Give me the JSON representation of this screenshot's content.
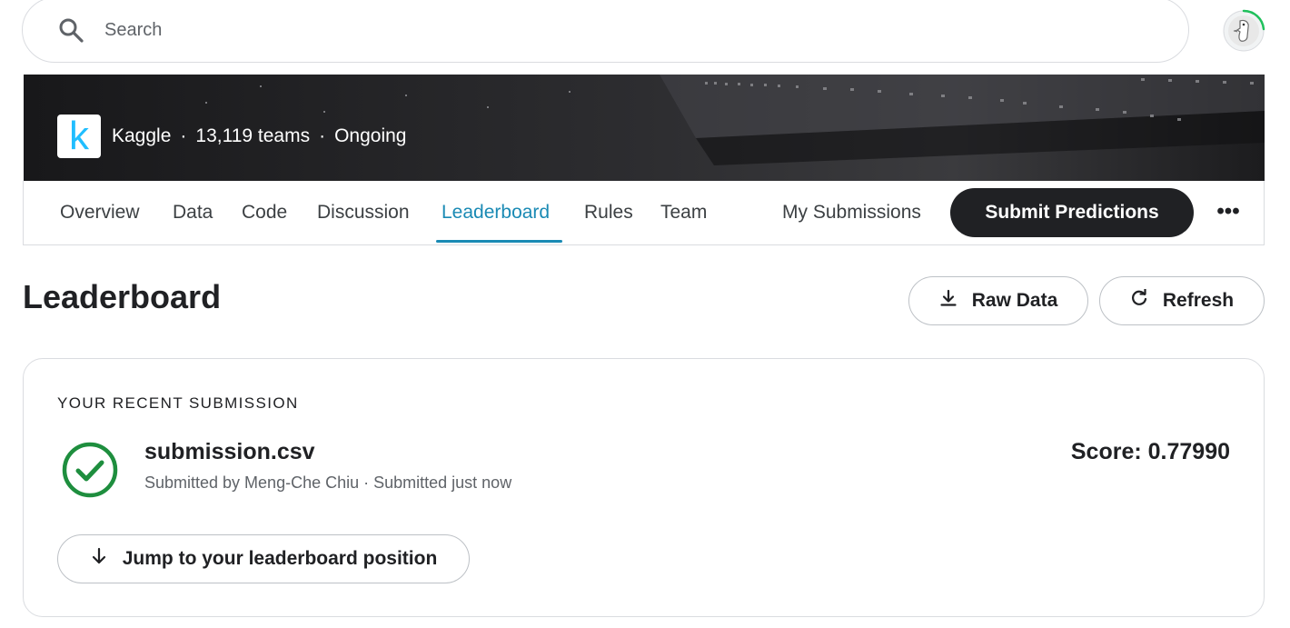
{
  "search": {
    "placeholder": "Search"
  },
  "competition": {
    "org": "Kaggle",
    "org_logo_letter": "k",
    "teams": "13,119 teams",
    "status": "Ongoing",
    "separator": "·"
  },
  "tabs": [
    {
      "label": "Overview"
    },
    {
      "label": "Data"
    },
    {
      "label": "Code"
    },
    {
      "label": "Discussion"
    },
    {
      "label": "Leaderboard",
      "active": true
    },
    {
      "label": "Rules"
    },
    {
      "label": "Team"
    }
  ],
  "actions": {
    "my_submissions": "My Submissions",
    "submit_predictions": "Submit Predictions",
    "more": "•••"
  },
  "page": {
    "title": "Leaderboard",
    "raw_data": "Raw Data",
    "refresh": "Refresh"
  },
  "recent_submission": {
    "label": "YOUR RECENT SUBMISSION",
    "file_name": "submission.csv",
    "meta": "Submitted by Meng-Che Chiu · Submitted just now",
    "score": "Score: 0.77990",
    "jump": "Jump to your leaderboard position",
    "status_icon": "check-circle-icon"
  },
  "colors": {
    "accent": "#1a8ab4",
    "success": "#1e8e3e",
    "primary_button": "#202124",
    "kaggle_blue": "#20beff"
  }
}
